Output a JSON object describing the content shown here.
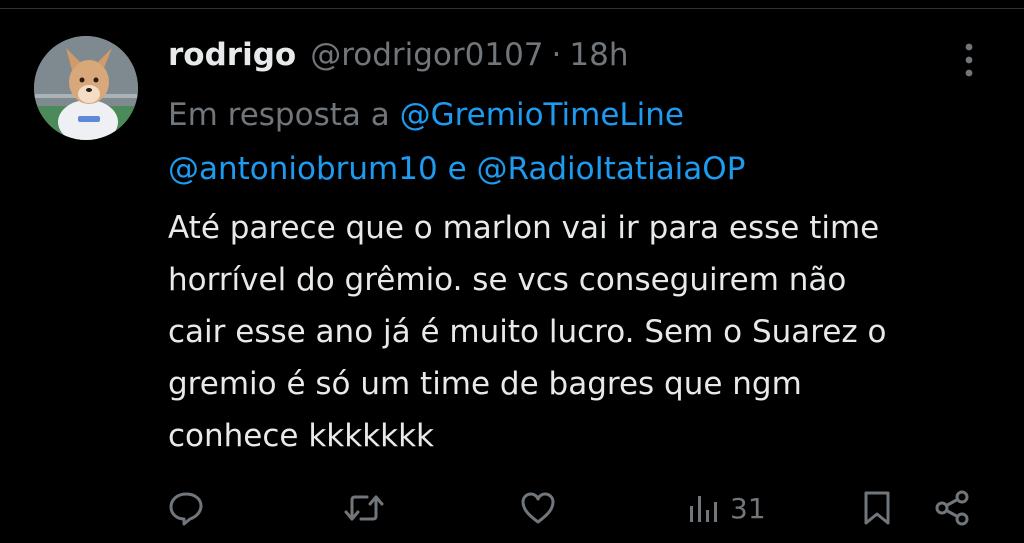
{
  "tweet": {
    "display_name": "rodrigo",
    "handle": "@rodrigor0107",
    "separator": "·",
    "time": "18h",
    "reply_prefix": "Em resposta a",
    "reply_mention_1": "@GremioTimeLine",
    "reply_mention_2": "@antoniobrum10",
    "reply_conjunction": "e",
    "reply_mention_3": "@RadioItatiaiaOP",
    "text": "Até parece que o marlon vai ir para esse time\nhorrível do grêmio. se vcs conseguirem não\ncair esse ano já é muito lucro. Sem o Suarez o\ngremio é só um time de bagres que ngm\nconhece kkkkkkk"
  },
  "actions": {
    "reply_icon": "reply-icon",
    "retweet_icon": "retweet-icon",
    "like_icon": "heart-icon",
    "views_icon": "views-icon",
    "views_count": "31",
    "bookmark_icon": "bookmark-icon",
    "share_icon": "share-icon"
  },
  "colors": {
    "background": "#000000",
    "text_primary": "#e7e9ea",
    "text_secondary": "#71767b",
    "link": "#1d9bf0"
  }
}
